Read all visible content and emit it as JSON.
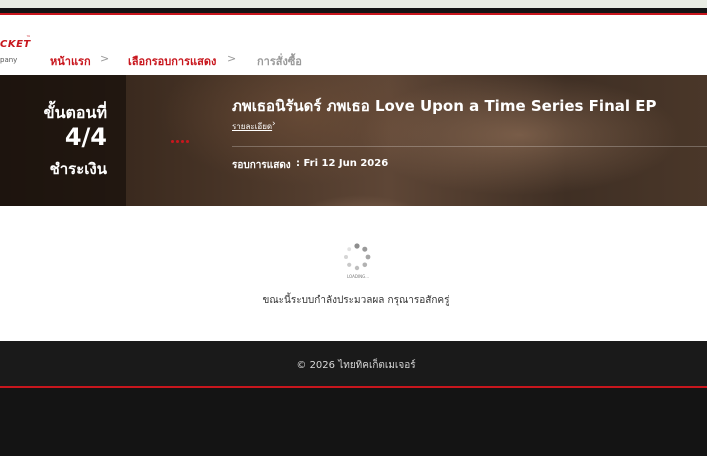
{
  "brand": {
    "logo_text": "CKET",
    "tm": "™",
    "sub": "pany",
    "accent_color": "#c8161d"
  },
  "breadcrumb": {
    "home": "หน้าแรก",
    "sep": ">",
    "select_round": "เลือกรอบการแสดง",
    "order": "การสั่งซื้อ"
  },
  "step": {
    "title": "ขั้นตอนที่",
    "number": "4/4",
    "label": "ชำระเงิน"
  },
  "event": {
    "title": "ภพเธอนิรันดร์ ภพเธอ Love Upon a Time Series Final EP",
    "detail_link": "รายละเอียด",
    "detail_arrow": "›",
    "round_label": "รอบการแสดง",
    "round_value": ": Fri 12 Jun 2026"
  },
  "loading": {
    "label": "LOADING...",
    "message": "ขณะนี้ระบบกำลังประมวลผล กรุณารอสักครู่"
  },
  "footer": {
    "copyright": "© 2026 ไทยทิคเก็ตเมเจอร์"
  }
}
